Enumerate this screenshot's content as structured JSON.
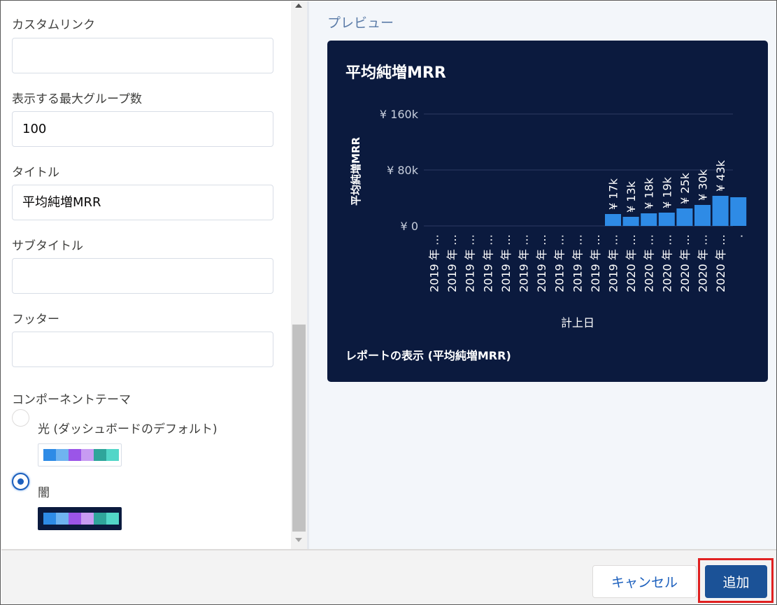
{
  "form": {
    "custom_link": {
      "label": "カスタムリンク",
      "value": ""
    },
    "max_groups": {
      "label": "表示する最大グループ数",
      "value": "100"
    },
    "title": {
      "label": "タイトル",
      "value": "平均純増MRR"
    },
    "subtitle": {
      "label": "サブタイトル",
      "value": ""
    },
    "footer": {
      "label": "フッター",
      "value": ""
    },
    "theme": {
      "label": "コンポーネントテーマ",
      "options": [
        {
          "label": "光 (ダッシュボードのデフォルト)",
          "checked": false
        },
        {
          "label": "闇",
          "checked": true
        }
      ],
      "palette": [
        "#2e8be6",
        "#6fb3f0",
        "#9b55e8",
        "#c79bf2",
        "#2fa59b",
        "#52d6c8"
      ]
    }
  },
  "preview": {
    "label": "プレビュー",
    "card_title": "平均純増MRR",
    "report_link": "レポートの表示 (平均純増MRR)"
  },
  "chart_data": {
    "type": "bar",
    "title": "平均純増MRR",
    "ylabel": "平均純増MRR",
    "xlabel": "計上日",
    "ylim": [
      0,
      160000
    ],
    "yticks": [
      {
        "value": 0,
        "label": "¥ 0"
      },
      {
        "value": 80000,
        "label": "¥ 80k"
      },
      {
        "value": 160000,
        "label": "¥ 160k"
      }
    ],
    "categories": [
      "2019 年 …",
      "2019 年 …",
      "2019 年 …",
      "2019 年 …",
      "2019 年 …",
      "2019 年 …",
      "2019 年 …",
      "2019 年 …",
      "2019 年 …",
      "2019 年 …",
      "2019 年 …",
      "2020 年 …",
      "2020 年 …",
      "2020 年 …",
      "2020 年 …",
      "2020 年 …",
      "2020 年 …",
      "."
    ],
    "values": [
      0,
      0,
      0,
      0,
      0,
      0,
      0,
      0,
      0,
      0,
      17000,
      13000,
      18000,
      19000,
      25000,
      30000,
      43000,
      41000
    ],
    "data_labels": [
      "",
      "",
      "",
      "",
      "",
      "",
      "",
      "",
      "",
      "",
      "¥ 17k",
      "¥ 13k",
      "¥ 18k",
      "¥ 19k",
      "¥ 25k",
      "¥ 30k",
      "¥ 43k",
      ""
    ],
    "bar_color": "#2e8be6",
    "grid": true
  },
  "footer": {
    "cancel_label": "キャンセル",
    "add_label": "追加"
  }
}
